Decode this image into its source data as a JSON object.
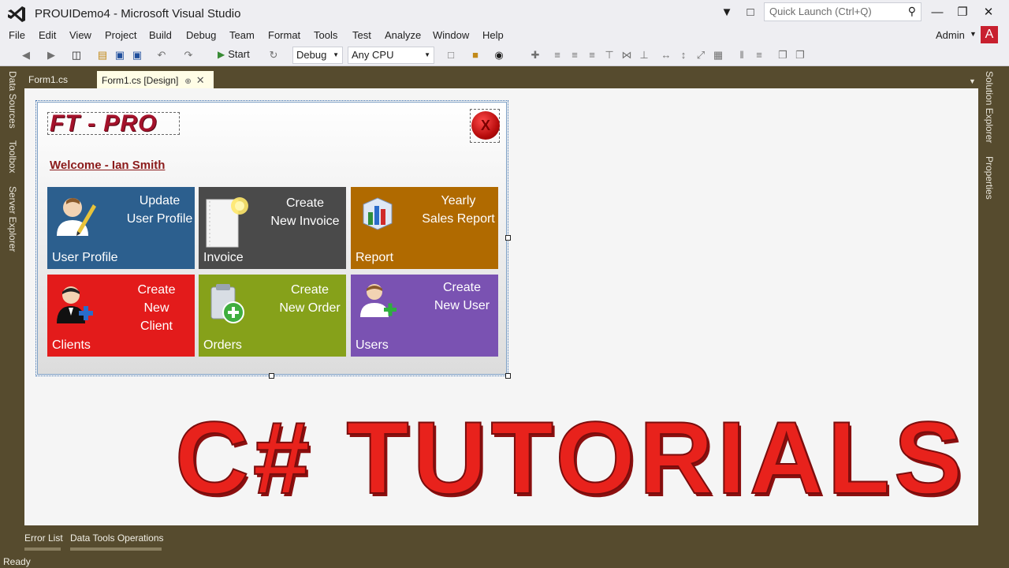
{
  "window": {
    "title": "PROUIDemo4 - Microsoft Visual Studio",
    "quick_launch_placeholder": "Quick Launch (Ctrl+Q)",
    "user": "Admin",
    "avatar_letter": "A"
  },
  "menu": [
    "File",
    "Edit",
    "View",
    "Project",
    "Build",
    "Debug",
    "Team",
    "Format",
    "Tools",
    "Test",
    "Analyze",
    "Window",
    "Help"
  ],
  "toolbar": {
    "start_label": "Start",
    "config": "Debug",
    "platform": "Any CPU"
  },
  "left_rail": [
    "Data Sources",
    "Toolbox",
    "Server Explorer"
  ],
  "right_rail": [
    "Solution Explorer",
    "Properties"
  ],
  "tabs": [
    {
      "label": "Form1.cs",
      "active": false
    },
    {
      "label": "Form1.cs [Design]",
      "active": true
    }
  ],
  "form": {
    "logo": "FT - PRO",
    "close_label": "X",
    "welcome": "Welcome - Ian Smith",
    "tiles": [
      {
        "line1": "Update",
        "line2": "User Profile",
        "name": "User Profile",
        "color": "#2c5f8e",
        "icon": "user-edit-icon"
      },
      {
        "line1": "Create",
        "line2": "New Invoice",
        "name": "Invoice",
        "color": "#4a4a4a",
        "icon": "invoice-icon"
      },
      {
        "line1": "Yearly",
        "line2": "Sales Report",
        "name": "Report",
        "color": "#b06a00",
        "icon": "report-chart-icon"
      },
      {
        "line1": "Create",
        "line2": "New Client",
        "name": "Clients",
        "color": "#e31b1b",
        "icon": "client-add-icon"
      },
      {
        "line1": "Create",
        "line2": "New Order",
        "name": "Orders",
        "color": "#86a11a",
        "icon": "order-add-icon"
      },
      {
        "line1": "Create",
        "line2": "New User",
        "name": "Users",
        "color": "#7a52b2",
        "icon": "user-add-icon"
      }
    ]
  },
  "overlay_title": "C# TUTORIALS",
  "bottom_tabs": [
    "Error List",
    "Data Tools Operations"
  ],
  "status": "Ready"
}
